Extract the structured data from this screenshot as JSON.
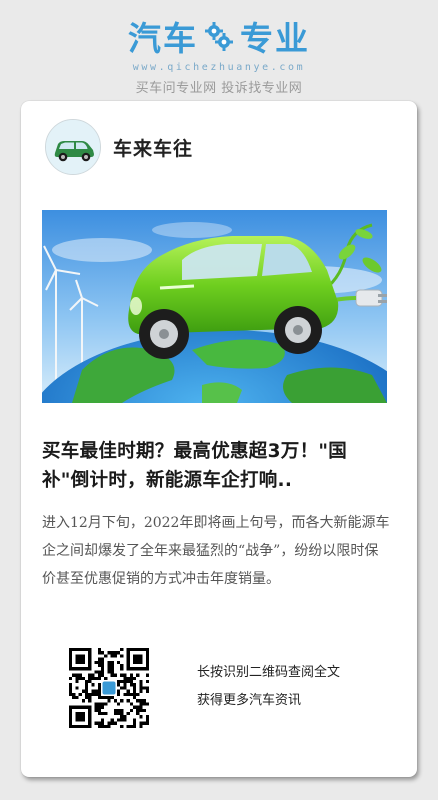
{
  "brand": {
    "logo_left": "汽车",
    "logo_right": "专业",
    "domain": "www.qichezhuanye.com",
    "slogan": "买车问专业网 投诉找专业网",
    "color": "#3a9ad6"
  },
  "author": {
    "name": "车来车往",
    "avatar_icon": "green-car-icon"
  },
  "hero": {
    "icon": "green-electric-car-on-globe-image"
  },
  "article": {
    "title": "买车最佳时期？最高优惠超3万！\"国补\"倒计时，新能源车企打响..",
    "summary": "进入12月下旬，2022年即将画上句号，而各大新能源车企之间却爆发了全年来最猛烈的“战争”，纷纷以限时保价甚至优惠促销的方式冲击年度销量。"
  },
  "qr": {
    "line1": "长按识别二维码查阅全文",
    "line2": "获得更多汽车资讯"
  }
}
